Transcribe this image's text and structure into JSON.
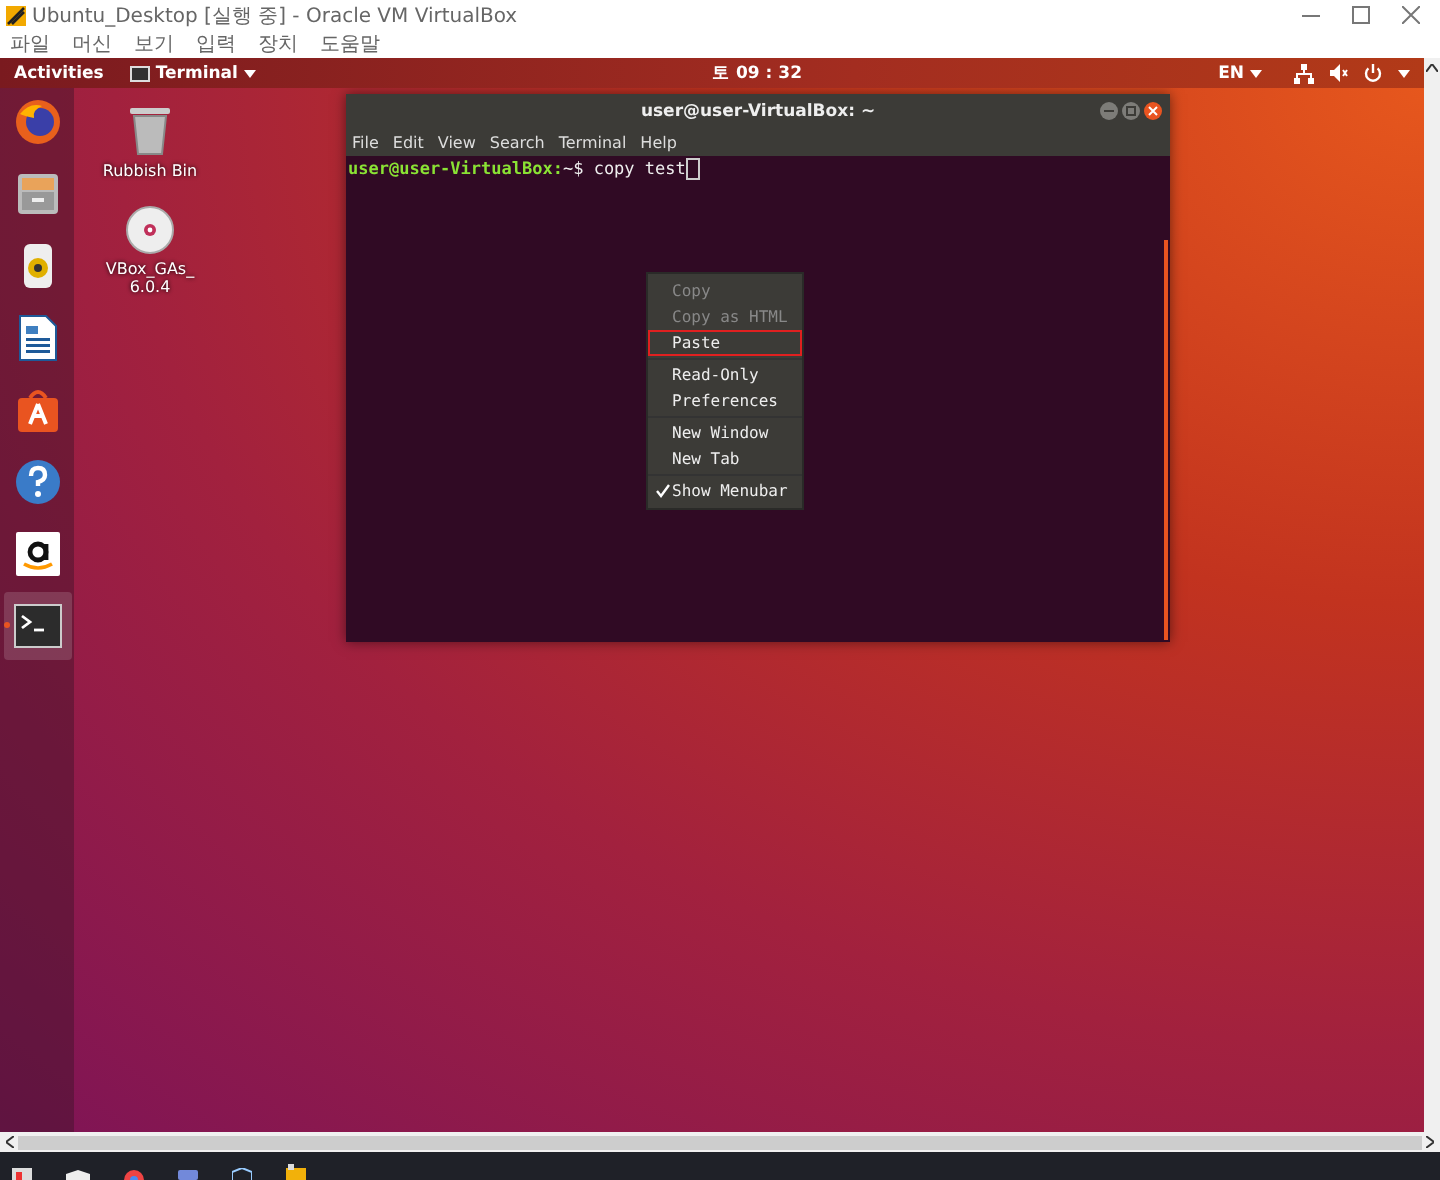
{
  "window": {
    "title": "Ubuntu_Desktop [실행 중] - Oracle VM VirtualBox"
  },
  "menu": [
    "파일",
    "머신",
    "보기",
    "입력",
    "장치",
    "도움말"
  ],
  "top_bar": {
    "activities": "Activities",
    "app_menu": "Terminal",
    "clock": "토 09 : 32",
    "language": "EN"
  },
  "dock": [
    {
      "kind": "browser",
      "active": false
    },
    {
      "kind": "files",
      "active": false
    },
    {
      "kind": "music",
      "active": false
    },
    {
      "kind": "document",
      "active": false
    },
    {
      "kind": "store",
      "active": false
    },
    {
      "kind": "help",
      "active": false
    },
    {
      "kind": "shop",
      "active": false
    },
    {
      "kind": "terminal",
      "active": true
    }
  ],
  "desktop_icons": [
    {
      "kind": "trash",
      "label": "Rubbish Bin"
    },
    {
      "kind": "disc",
      "label": "VBox_GAs_6.0.4"
    }
  ],
  "terminal": {
    "title": "user@user-VirtualBox: ~",
    "menu": [
      "File",
      "Edit",
      "View",
      "Search",
      "Terminal",
      "Help"
    ],
    "prompt": "user@user-VirtualBox:",
    "command": "~$ copy test"
  },
  "context_menu": {
    "groups": [
      [
        {
          "label": "Copy",
          "disabled": true,
          "highlighted": false,
          "checked": false
        },
        {
          "label": "Copy as HTML",
          "disabled": true,
          "highlighted": false,
          "checked": false
        },
        {
          "label": "Paste",
          "disabled": false,
          "highlighted": true,
          "checked": false
        }
      ],
      [
        {
          "label": "Read-Only",
          "disabled": false,
          "highlighted": false,
          "checked": false
        },
        {
          "label": "Preferences",
          "disabled": false,
          "highlighted": false,
          "checked": false
        }
      ],
      [
        {
          "label": "New Window",
          "disabled": false,
          "highlighted": false,
          "checked": false
        },
        {
          "label": "New Tab",
          "disabled": false,
          "highlighted": false,
          "checked": false
        }
      ],
      [
        {
          "label": "Show Menubar",
          "disabled": false,
          "highlighted": false,
          "checked": true
        }
      ]
    ]
  }
}
